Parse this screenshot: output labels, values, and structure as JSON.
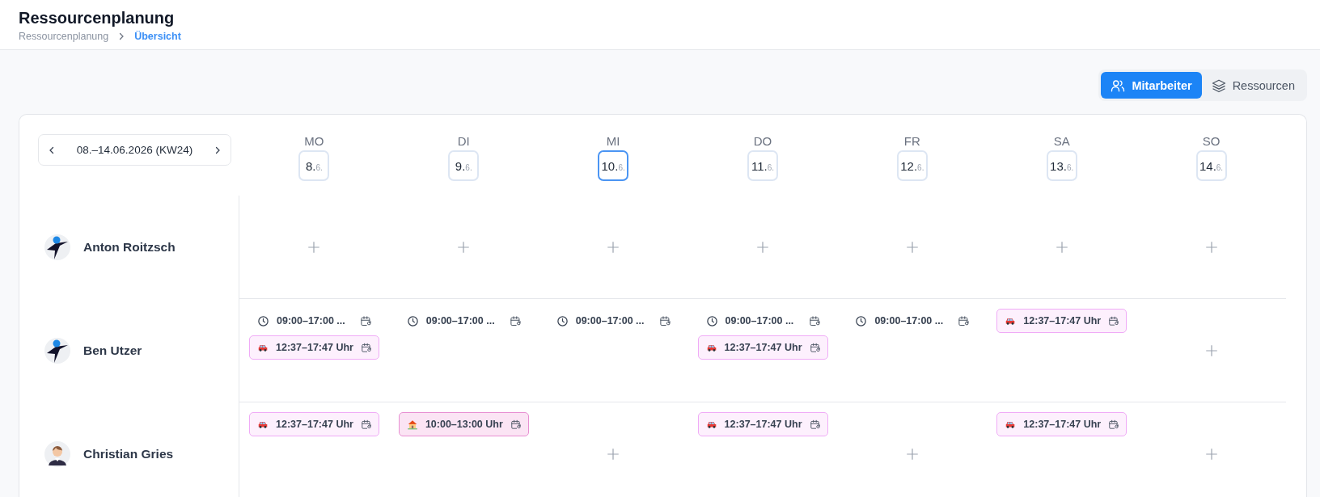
{
  "page": {
    "title": "Ressourcenplanung",
    "breadcrumb": [
      {
        "label": "Ressourcenplanung",
        "current": false
      },
      {
        "label": "Übersicht",
        "current": true
      }
    ]
  },
  "view_toggle": [
    {
      "label": "Mitarbeiter",
      "kind": "users",
      "selected": true
    },
    {
      "label": "Ressourcen",
      "kind": "layers",
      "selected": false
    }
  ],
  "week_nav": {
    "label": "08.–14.06.2026 (KW24)"
  },
  "days": [
    {
      "weekday": "MO",
      "day": "8.",
      "month": "6.",
      "selected": false
    },
    {
      "weekday": "DI",
      "day": "9.",
      "month": "6.",
      "selected": false
    },
    {
      "weekday": "MI",
      "day": "10.",
      "month": "6.",
      "selected": true
    },
    {
      "weekday": "DO",
      "day": "11.",
      "month": "6.",
      "selected": false
    },
    {
      "weekday": "FR",
      "day": "12.",
      "month": "6.",
      "selected": false
    },
    {
      "weekday": "SA",
      "day": "13.",
      "month": "6.",
      "selected": false
    },
    {
      "weekday": "SO",
      "day": "14.",
      "month": "6.",
      "selected": false
    }
  ],
  "employees": [
    {
      "name": "Anton Roitzsch",
      "avatar": {
        "kind": "logo"
      },
      "cells": [
        [],
        [],
        [],
        [],
        [],
        [],
        []
      ]
    },
    {
      "name": "Ben Utzer",
      "avatar": {
        "kind": "logo"
      },
      "cells": [
        [
          {
            "kind": "time",
            "label": "09:00–17:00 ..."
          },
          {
            "kind": "car",
            "label": "12:37–17:47 Uhr"
          }
        ],
        [
          {
            "kind": "time",
            "label": "09:00–17:00 ..."
          }
        ],
        [
          {
            "kind": "time",
            "label": "09:00–17:00 ..."
          }
        ],
        [
          {
            "kind": "time",
            "label": "09:00–17:00 ..."
          },
          {
            "kind": "car",
            "label": "12:37–17:47 Uhr"
          }
        ],
        [
          {
            "kind": "time",
            "label": "09:00–17:00 ..."
          }
        ],
        [
          {
            "kind": "car",
            "label": "12:37–17:47 Uhr"
          }
        ],
        []
      ]
    },
    {
      "name": "Christian Gries",
      "avatar": {
        "kind": "person"
      },
      "cells": [
        [
          {
            "kind": "car",
            "label": "12:37–17:47 Uhr"
          }
        ],
        [
          {
            "kind": "home",
            "label": "10:00–13:00 Uhr"
          }
        ],
        [],
        [
          {
            "kind": "car",
            "label": "12:37–17:47 Uhr"
          }
        ],
        [],
        [
          {
            "kind": "car",
            "label": "12:37–17:47 Uhr"
          }
        ],
        []
      ]
    }
  ]
}
